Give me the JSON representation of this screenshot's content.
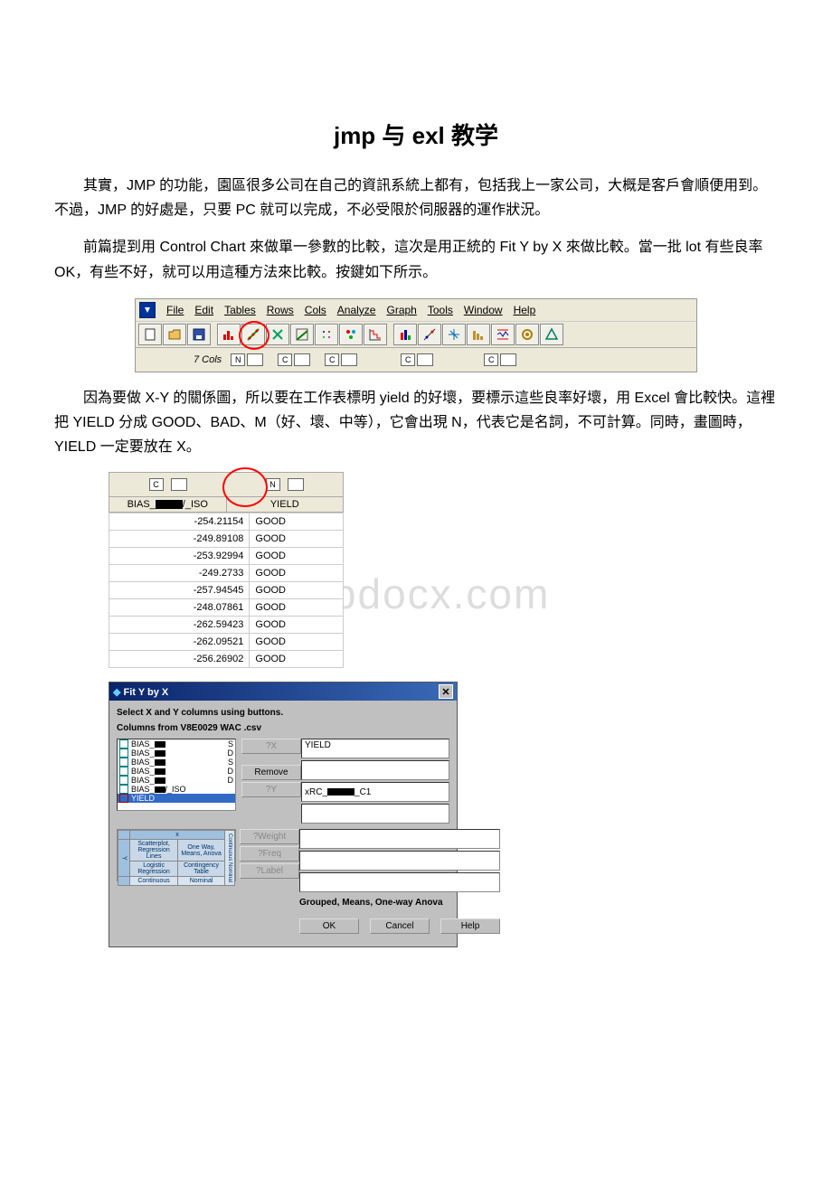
{
  "title": "jmp 与 exl 教学",
  "paragraphs": {
    "p1": "其實，JMP 的功能，園區很多公司在自己的資訊系統上都有，包括我上一家公司，大概是客戶會順便用到。不過，JMP 的好處是，只要 PC 就可以完成，不必受限於伺服器的運作狀況。",
    "p2": "前篇提到用 Control Chart 來做單一參數的比較，這次是用正統的 Fit Y by X 來做比較。當一批 lot 有些良率 OK，有些不好，就可以用這種方法來比較。按鍵如下所示。",
    "p3": "因為要做 X-Y 的關係圖，所以要在工作表標明 yield 的好壞，要標示這些良率好壞，用 Excel 會比較快。這裡把 YIELD 分成 GOOD、BAD、M（好、壞、中等），它會出現 N，代表它是名詞，不可計算。同時，畫圖時，YIELD 一定要放在 X。"
  },
  "watermark": "www.bdocx.com",
  "toolbar": {
    "menus": [
      "File",
      "Edit",
      "Tables",
      "Rows",
      "Cols",
      "Analyze",
      "Graph",
      "Tools",
      "Window",
      "Help"
    ],
    "cols_label": "7 Cols",
    "type_n": "N",
    "type_c": "C"
  },
  "datatable": {
    "type_c": "C",
    "type_n": "N",
    "col1_label": "BIAS_",
    "col1_suffix": "/_ISO",
    "col2_label": "YIELD",
    "rows": [
      [
        "-254.21154",
        "GOOD"
      ],
      [
        "-249.89108",
        "GOOD"
      ],
      [
        "-253.92994",
        "GOOD"
      ],
      [
        "-249.2733",
        "GOOD"
      ],
      [
        "-257.94545",
        "GOOD"
      ],
      [
        "-248.07861",
        "GOOD"
      ],
      [
        "-262.59423",
        "GOOD"
      ],
      [
        "-262.09521",
        "GOOD"
      ],
      [
        "-256.26902",
        "GOOD"
      ]
    ]
  },
  "dialog": {
    "title": "Fit Y by X",
    "inst1": "Select X and Y columns using buttons.",
    "inst2": "Columns from V8E0029 WAC .csv",
    "columns": [
      "BIAS_",
      "BIAS_",
      "BIAS_",
      "BIAS_",
      "BIAS_",
      "BIAS_",
      "YIELD"
    ],
    "col_suffix": [
      "S",
      "D",
      "S",
      "D",
      "D",
      "/_ISO",
      ""
    ],
    "btn_yx": "?X",
    "btn_remove": "Remove",
    "btn_yy": "?Y",
    "btn_weight": "?Weight",
    "btn_freq": "?Freq",
    "btn_label": "?Label",
    "y_field": "YIELD",
    "x_field_prefix": "xRC_",
    "x_field_suffix": "_C1",
    "preview": {
      "header_x": "x",
      "cell_00": "Scatterplot, Regression Lines",
      "cell_01": "One Way, Means, Anova",
      "cell_10": "Logistic Regression",
      "cell_11": "Contingency Table",
      "footer_0": "Continuous",
      "footer_1": "Nominal",
      "side_cn": "Continuous  Nominal",
      "y_label": "Y"
    },
    "grouped": "Grouped, Means, One-way Anova",
    "btn_ok": "OK",
    "btn_cancel": "Cancel",
    "btn_help": "Help"
  }
}
